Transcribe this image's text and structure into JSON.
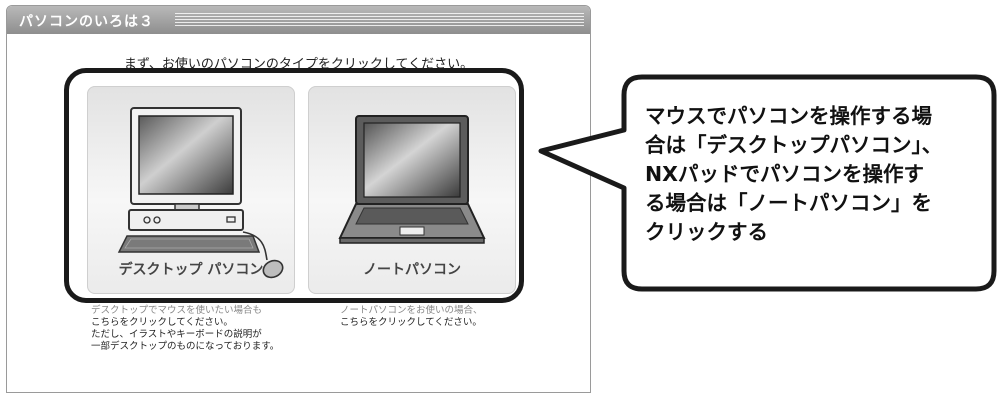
{
  "window": {
    "title": "パソコンのいろは３",
    "instruction": "まず、お使いのパソコンのタイプをクリックしてください。"
  },
  "options": {
    "desktop": {
      "label": "デスクトップ パソコン",
      "desc_clipped": "デスクトップでマウスを使いたい場合も",
      "desc_lines": [
        "こちらをクリックしてください。",
        "ただし、イラストやキーボードの説明が",
        "一部デスクトップのものになっております。"
      ]
    },
    "note": {
      "label": "ノートパソコン",
      "desc_clipped": "ノートパソコンをお使いの場合、",
      "desc_lines": [
        "こちらをクリックしてください。"
      ]
    }
  },
  "callout": {
    "text": "マウスでパソコンを操作する場\n合は「デスクトップパソコン」、\nNXパッドでパソコンを操作す\nる場合は「ノートパソコン」を\nクリックする"
  },
  "colors": {
    "highlight": "#1a1a1a",
    "titlebar": "#9e9e9e",
    "card": "#ededed"
  }
}
